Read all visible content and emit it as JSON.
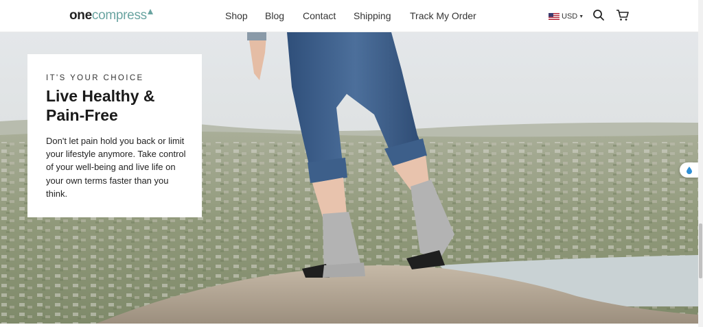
{
  "header": {
    "logo": {
      "part1": "one",
      "part2": "compress"
    },
    "nav": [
      {
        "label": "Shop"
      },
      {
        "label": "Blog"
      },
      {
        "label": "Contact"
      },
      {
        "label": "Shipping"
      },
      {
        "label": "Track My Order"
      }
    ],
    "currency": {
      "flag": "us-flag-icon",
      "code": "USD"
    },
    "icons": [
      "search-icon",
      "cart-icon"
    ]
  },
  "hero": {
    "eyebrow": "IT'S YOUR CHOICE",
    "headline": "Live Healthy & Pain-Free",
    "body": "Don't let pain hold you back or limit your lifestyle anymore. Take control of your well-being and live life on your own terms faster than you think.",
    "image": "man-on-rock-wearing-compression-socks"
  },
  "widget": {
    "icon": "water-drop-icon"
  },
  "colors": {
    "logo_accent": "#6aa4a1",
    "text_dark": "#1a1a1a",
    "nav_text": "#333333"
  }
}
